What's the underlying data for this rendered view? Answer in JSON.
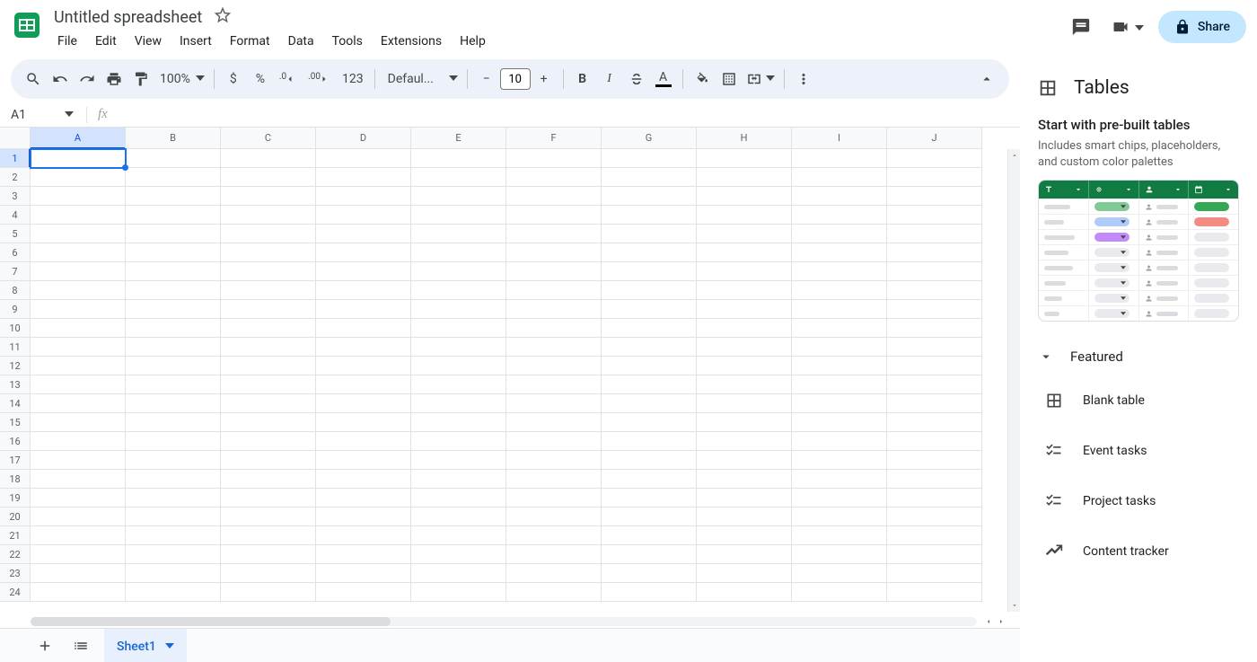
{
  "header": {
    "doc_title": "Untitled spreadsheet",
    "menu": [
      "File",
      "Edit",
      "View",
      "Insert",
      "Format",
      "Data",
      "Tools",
      "Extensions",
      "Help"
    ],
    "share_label": "Share"
  },
  "toolbar": {
    "zoom": "100%",
    "decimal_decrease": ".0",
    "decimal_increase": ".00",
    "number_format": "123",
    "font": "Defaul...",
    "font_size": "10",
    "minus": "−",
    "plus": "+",
    "currency": "$",
    "percent": "%",
    "bold": "B",
    "italic": "I",
    "text_color_letter": "A"
  },
  "formula_bar": {
    "name_box": "A1"
  },
  "grid": {
    "columns": [
      "A",
      "B",
      "C",
      "D",
      "E",
      "F",
      "G",
      "H",
      "I",
      "J"
    ],
    "rows": [
      1,
      2,
      3,
      4,
      5,
      6,
      7,
      8,
      9,
      10,
      11,
      12,
      13,
      14,
      15,
      16,
      17,
      18,
      19,
      20,
      21,
      22,
      23,
      24
    ],
    "active_cell": "A1"
  },
  "sheet_tabs": {
    "active_tab": "Sheet1"
  },
  "side_panel": {
    "title": "Tables",
    "start_title": "Start with pre-built tables",
    "start_desc": "Includes smart chips, placeholders, and custom color palettes",
    "group": "Featured",
    "items": [
      "Blank table",
      "Event tasks",
      "Project tasks",
      "Content tracker"
    ]
  }
}
